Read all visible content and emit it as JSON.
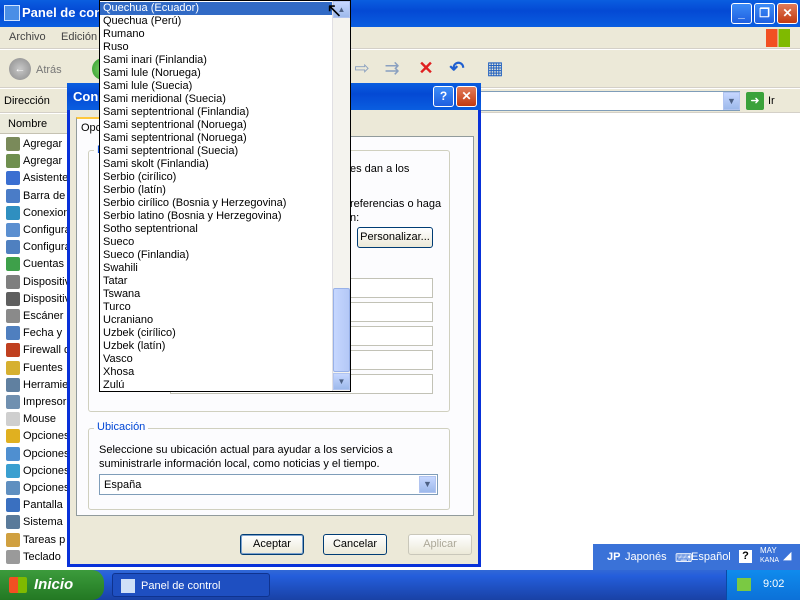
{
  "main_window": {
    "title": "Panel de control",
    "menu": [
      "Archivo",
      "Edición"
    ],
    "toolbar": {
      "back_label": "Atrás"
    },
    "address": {
      "label": "Dirección",
      "go_label": "Ir"
    },
    "column_header": "Nombre",
    "items": [
      "Agregar",
      "Agregar",
      "Asistente",
      "Barra de",
      "Conexion",
      "Configura",
      "Configura",
      "Cuentas",
      "Dispositiv",
      "Dispositiv",
      "Escáner",
      "Fecha y",
      "Firewall d",
      "Fuentes",
      "Herramie",
      "Impresor",
      "Mouse",
      "Opciones",
      "Opciones",
      "Opciones",
      "Opciones",
      "Pantalla",
      "Sistema",
      "Tareas p",
      "Teclado"
    ],
    "item_icon_colors": [
      "#7a8a5a",
      "#6f8f4f",
      "#3b6fd1",
      "#4a7cc7",
      "#2f8fc0",
      "#5b8fd0",
      "#4f80c0",
      "#3ea04a",
      "#7f7f7f",
      "#5f5f5f",
      "#8a8a8a",
      "#4f7fbf",
      "#c04020",
      "#d6b030",
      "#6080a0",
      "#7090b0",
      "#cfcfcf",
      "#e0b020",
      "#4f8fd0",
      "#3a9fd0",
      "#5f8fc0",
      "#3a70c0",
      "#5a7a9a",
      "#d0a040",
      "#9a9a9a"
    ]
  },
  "dialog": {
    "title": "Configuración regional y de idioma",
    "title_visible": "Con",
    "tab_label": "Opc",
    "group1_label": "E",
    "partial_text_1": "es dan a los",
    "partial_text_2": "referencias o haga",
    "partial_text_3": "n:",
    "customize_button": "Personalizar...",
    "location": {
      "group_label": "Ubicación",
      "description": "Seleccione su ubicación actual para ayudar a los servicios a suministrarle información local, como noticias y el tiempo.",
      "selected": "España"
    },
    "buttons": {
      "ok": "Aceptar",
      "cancel": "Cancelar",
      "apply": "Aplicar"
    }
  },
  "dropdown": {
    "selected": "Quechua (Ecuador)",
    "items": [
      "Quechua (Ecuador)",
      "Quechua (Perú)",
      "Rumano",
      "Ruso",
      "Sami inari (Finlandia)",
      "Sami lule (Noruega)",
      "Sami lule (Suecia)",
      "Sami meridional (Suecia)",
      "Sami septentrional (Finlandia)",
      "Sami septentrional (Noruega)",
      "Sami septentrional (Noruega)",
      "Sami septentrional (Suecia)",
      "Sami skolt (Finlandia)",
      "Serbio (cirílico)",
      "Serbio (latín)",
      "Serbio cirílico (Bosnia y Herzegovina)",
      "Serbio latino (Bosnia y Herzegovina)",
      "Sotho septentrional",
      "Sueco",
      "Sueco (Finlandia)",
      "Swahili",
      "Tatar",
      "Tswana",
      "Turco",
      "Ucraniano",
      "Uzbek (cirílico)",
      "Uzbek (latín)",
      "Vasco",
      "Xhosa",
      "Zulú"
    ]
  },
  "language_bar": {
    "code": "JP",
    "language": "Japonés",
    "keyboard": "Español",
    "mode_top": "MAY",
    "mode_bottom": "KANA"
  },
  "taskbar": {
    "start_label": "Inicio",
    "task_label": "Panel de control",
    "clock": "9:02"
  },
  "colors": {
    "xp_blue": "#0a5ee0",
    "selection": "#316ac5",
    "start_green": "#2f8a2f"
  }
}
